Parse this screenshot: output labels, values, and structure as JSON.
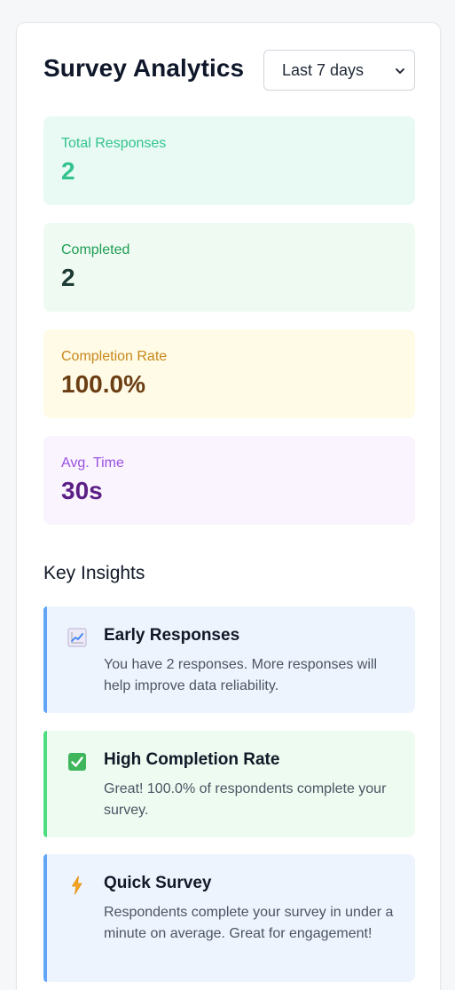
{
  "header": {
    "title": "Survey Analytics",
    "range_selected": "Last 7 days"
  },
  "stats": [
    {
      "label": "Total Responses",
      "value": "2",
      "accent": "#34c38f"
    },
    {
      "label": "Completed",
      "value": "2",
      "accent": "#1f9d55"
    },
    {
      "label": "Completion Rate",
      "value": "100.0%",
      "accent": "#c8871a"
    },
    {
      "label": "Avg. Time",
      "value": "30s",
      "accent": "#9b51e0"
    }
  ],
  "insights_heading": "Key Insights",
  "insights": [
    {
      "icon": "chart-increasing-icon",
      "title": "Early Responses",
      "text": "You have 2 responses. More responses will help improve data reliability.",
      "accent": "#60a5fa"
    },
    {
      "icon": "check-box-icon",
      "title": "High Completion Rate",
      "text": "Great! 100.0% of respondents complete your survey.",
      "accent": "#4ade80"
    },
    {
      "icon": "lightning-icon",
      "title": "Quick Survey",
      "text": "Respondents complete your survey in under a minute on average. Great for engagement!",
      "accent": "#60a5fa"
    }
  ]
}
